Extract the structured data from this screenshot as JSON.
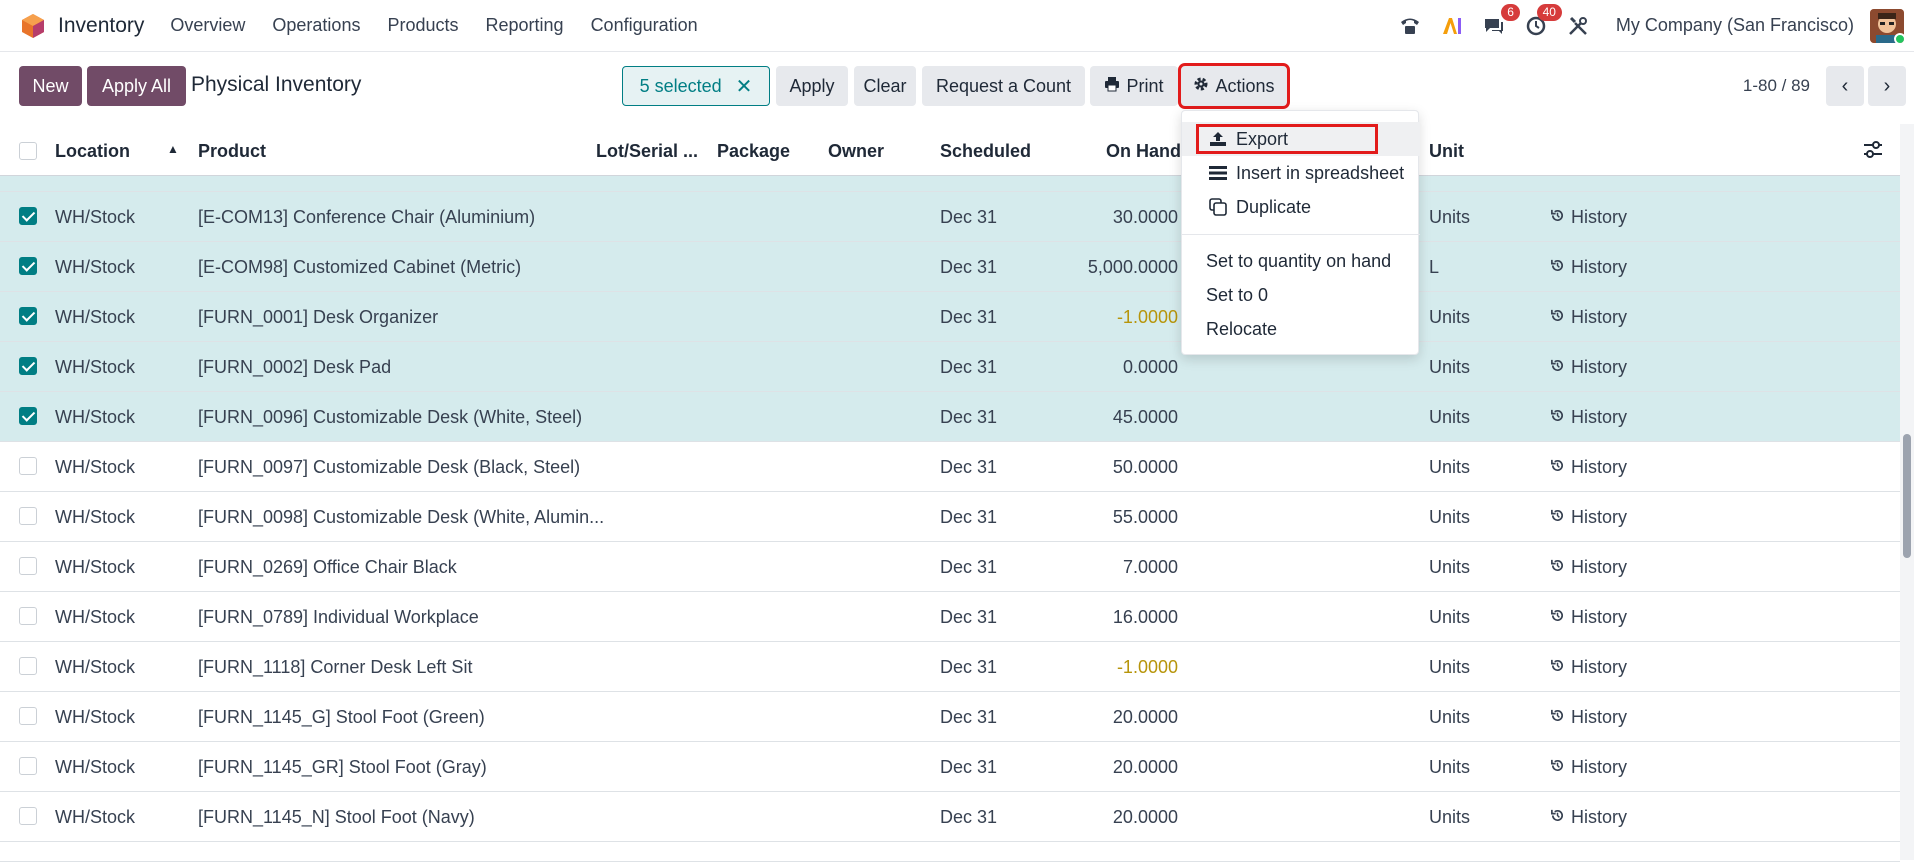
{
  "navbar": {
    "app_name": "Inventory",
    "menu": [
      "Overview",
      "Operations",
      "Products",
      "Reporting",
      "Configuration"
    ],
    "icons": [
      "phone-icon",
      "ai-icon",
      "chat-icon",
      "activity-clock-icon",
      "tools-icon"
    ],
    "chat_badge": "6",
    "activity_badge": "40",
    "company": "My Company (San Francisco)"
  },
  "control": {
    "new_label": "New",
    "apply_all_label": "Apply All",
    "page_title": "Physical Inventory",
    "selected_label": "5 selected",
    "apply_label": "Apply",
    "clear_label": "Clear",
    "request_count_label": "Request a Count",
    "print_label": "Print",
    "actions_label": "Actions",
    "pager": "1-80 / 89"
  },
  "columns": {
    "location": "Location",
    "product": "Product",
    "lot": "Lot/Serial ...",
    "package": "Package",
    "owner": "Owner",
    "scheduled": "Scheduled",
    "on_hand": "On Hand",
    "unit": "Unit"
  },
  "rows": [
    {
      "location": "WH/Stock",
      "product": "[E-COM13] Conference Chair (Aluminium)",
      "scheduled": "Dec 31",
      "on_hand": "30.0000",
      "unit": "Units",
      "history": "History",
      "selected": true,
      "neg": false
    },
    {
      "location": "WH/Stock",
      "product": "[E-COM98] Customized Cabinet (Metric)",
      "scheduled": "Dec 31",
      "on_hand": "5,000.0000",
      "unit": "L",
      "history": "History",
      "selected": true,
      "neg": false
    },
    {
      "location": "WH/Stock",
      "product": "[FURN_0001] Desk Organizer",
      "scheduled": "Dec 31",
      "on_hand": "-1.0000",
      "unit": "Units",
      "history": "History",
      "selected": true,
      "neg": true
    },
    {
      "location": "WH/Stock",
      "product": "[FURN_0002] Desk Pad",
      "scheduled": "Dec 31",
      "on_hand": "0.0000",
      "unit": "Units",
      "history": "History",
      "selected": true,
      "neg": false
    },
    {
      "location": "WH/Stock",
      "product": "[FURN_0096] Customizable Desk (White, Steel)",
      "scheduled": "Dec 31",
      "on_hand": "45.0000",
      "unit": "Units",
      "history": "History",
      "selected": true,
      "neg": false
    },
    {
      "location": "WH/Stock",
      "product": "[FURN_0097] Customizable Desk (Black, Steel)",
      "scheduled": "Dec 31",
      "on_hand": "50.0000",
      "unit": "Units",
      "history": "History",
      "selected": false,
      "neg": false
    },
    {
      "location": "WH/Stock",
      "product": "[FURN_0098] Customizable Desk (White, Alumin...",
      "scheduled": "Dec 31",
      "on_hand": "55.0000",
      "unit": "Units",
      "history": "History",
      "selected": false,
      "neg": false
    },
    {
      "location": "WH/Stock",
      "product": "[FURN_0269] Office Chair Black",
      "scheduled": "Dec 31",
      "on_hand": "7.0000",
      "unit": "Units",
      "history": "History",
      "selected": false,
      "neg": false
    },
    {
      "location": "WH/Stock",
      "product": "[FURN_0789] Individual Workplace",
      "scheduled": "Dec 31",
      "on_hand": "16.0000",
      "unit": "Units",
      "history": "History",
      "selected": false,
      "neg": false
    },
    {
      "location": "WH/Stock",
      "product": "[FURN_1118] Corner Desk Left Sit",
      "scheduled": "Dec 31",
      "on_hand": "-1.0000",
      "unit": "Units",
      "history": "History",
      "selected": false,
      "neg": true
    },
    {
      "location": "WH/Stock",
      "product": "[FURN_1145_G] Stool Foot (Green)",
      "scheduled": "Dec 31",
      "on_hand": "20.0000",
      "unit": "Units",
      "history": "History",
      "selected": false,
      "neg": false
    },
    {
      "location": "WH/Stock",
      "product": "[FURN_1145_GR] Stool Foot (Gray)",
      "scheduled": "Dec 31",
      "on_hand": "20.0000",
      "unit": "Units",
      "history": "History",
      "selected": false,
      "neg": false
    },
    {
      "location": "WH/Stock",
      "product": "[FURN_1145_N] Stool Foot (Navy)",
      "scheduled": "Dec 31",
      "on_hand": "20.0000",
      "unit": "Units",
      "history": "History",
      "selected": false,
      "neg": false
    }
  ],
  "dropdown": {
    "export": "Export",
    "insert": "Insert in spreadsheet",
    "duplicate": "Duplicate",
    "set_qty": "Set to quantity on hand",
    "set_zero": "Set to 0",
    "relocate": "Relocate"
  },
  "colors": {
    "primary": "#714b67",
    "accent": "#017e84",
    "selected_row": "#d5ebed",
    "negative": "#b7950b",
    "highlight": "#e21b1b"
  }
}
